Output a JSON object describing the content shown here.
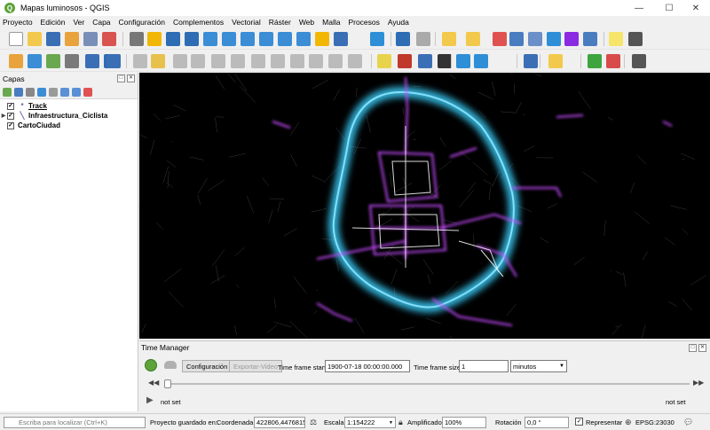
{
  "window": {
    "title": "Mapas luminosos - QGIS"
  },
  "menu": [
    "Proyecto",
    "Edición",
    "Ver",
    "Capa",
    "Configuración",
    "Complementos",
    "Vectorial",
    "Ráster",
    "Web",
    "Malla",
    "Procesos",
    "Ayuda"
  ],
  "toolbar_top": [
    {
      "icon": "new-project-icon",
      "color": "#ffffff"
    },
    {
      "icon": "open-project-icon",
      "color": "#f2c94c"
    },
    {
      "icon": "save-project-icon",
      "color": "#3b6fb5"
    },
    {
      "icon": "save-as-icon",
      "color": "#e8a33c"
    },
    {
      "icon": "print-layout-icon",
      "color": "#7a8fb8"
    },
    {
      "icon": "style-manager-icon",
      "color": "#d9534f"
    },
    {
      "icon": "pan-icon",
      "color": "#777777"
    },
    {
      "icon": "pan-to-selection-icon",
      "color": "#f2b705"
    },
    {
      "icon": "zoom-in-icon",
      "color": "#2e6db4"
    },
    {
      "icon": "zoom-out-icon",
      "color": "#2e6db4"
    },
    {
      "icon": "zoom-full-icon",
      "color": "#3b8dd6"
    },
    {
      "icon": "zoom-selection-icon",
      "color": "#3b8dd6"
    },
    {
      "icon": "zoom-layer-icon",
      "color": "#3b8dd6"
    },
    {
      "icon": "zoom-native-icon",
      "color": "#3b8dd6"
    },
    {
      "icon": "zoom-last-icon",
      "color": "#3b8dd6"
    },
    {
      "icon": "zoom-next-icon",
      "color": "#3b8dd6"
    },
    {
      "icon": "new-bookmark-icon",
      "color": "#f2b705"
    },
    {
      "icon": "show-bookmarks-icon",
      "color": "#3b6fb5"
    },
    {
      "icon": "refresh-icon",
      "color": "#2e8fd6"
    },
    {
      "icon": "identify-icon",
      "color": "#2e6db4"
    },
    {
      "icon": "action-icon",
      "color": "#aaaaaa"
    },
    {
      "icon": "select-feature-icon",
      "color": "#f2c94c"
    },
    {
      "icon": "select-value-icon",
      "color": "#f2c94c"
    },
    {
      "icon": "deselect-icon",
      "color": "#e05252"
    },
    {
      "icon": "attribute-table-icon",
      "color": "#4a7cc0"
    },
    {
      "icon": "field-calculator-icon",
      "color": "#6b8fc9"
    },
    {
      "icon": "toolbox-icon",
      "color": "#2e8fd6"
    },
    {
      "icon": "statistics-icon",
      "color": "#8a2be2"
    },
    {
      "icon": "measure-icon",
      "color": "#4a7cc0"
    },
    {
      "icon": "map-tips-icon",
      "color": "#f7e46b"
    },
    {
      "icon": "text-annotation-icon",
      "color": "#555555"
    }
  ],
  "toolbar_second": [
    {
      "icon": "datasource-manager-icon",
      "color": "#e8a33c"
    },
    {
      "icon": "new-geopackage-icon",
      "color": "#3b8dd6"
    },
    {
      "icon": "add-vector-icon",
      "color": "#6aa84f"
    },
    {
      "icon": "add-delimited-text-icon",
      "color": "#7a7a7a"
    },
    {
      "icon": "new-shapefile-icon",
      "color": "#3b6fb5"
    },
    {
      "icon": "new-spatialite-icon",
      "color": "#2e6db4"
    },
    {
      "icon": "virtual-layer-icon",
      "color": "#3b6fb5"
    },
    {
      "icon": "edit-pencil-icon",
      "color": "#bbbbbb"
    },
    {
      "icon": "toggle-edit-icon",
      "color": "#e8c04c"
    },
    {
      "icon": "save-edits-icon",
      "color": "#bbbbbb"
    },
    {
      "icon": "digitize-icon",
      "color": "#bbbbbb"
    },
    {
      "icon": "vertex-tool-icon",
      "color": "#bbbbbb"
    },
    {
      "icon": "modify-attributes-icon",
      "color": "#bbbbbb"
    },
    {
      "icon": "delete-selected-icon",
      "color": "#bbbbbb"
    },
    {
      "icon": "cut-features-icon",
      "color": "#bbbbbb"
    },
    {
      "icon": "copy-features-icon",
      "color": "#bbbbbb"
    },
    {
      "icon": "paste-features-icon",
      "color": "#bbbbbb"
    },
    {
      "icon": "undo-icon",
      "color": "#bbbbbb"
    },
    {
      "icon": "redo-icon",
      "color": "#bbbbbb"
    },
    {
      "icon": "label-toolbar-icon",
      "color": "#e8d44c"
    },
    {
      "icon": "layer-labeling-icon",
      "color": "#c0392b"
    },
    {
      "icon": "label-options-icon",
      "color": "#3b6fb5"
    },
    {
      "icon": "more-tools-icon",
      "color": "#333333"
    },
    {
      "icon": "time-manager-icon",
      "color": "#2e8fd6"
    },
    {
      "icon": "time-settings-icon",
      "color": "#2e8fd6"
    },
    {
      "icon": "help-icon",
      "color": "#3b6fb5"
    },
    {
      "icon": "python-console-icon",
      "color": "#f2c94c"
    },
    {
      "icon": "search-plugin-icon",
      "color": "#3ea53e"
    },
    {
      "icon": "plugin-tool-icon",
      "color": "#d94b4b"
    },
    {
      "icon": "whats-this-icon",
      "color": "#555555"
    }
  ],
  "layers_panel": {
    "title": "Capas",
    "layers": [
      {
        "name": "Track",
        "checked": true,
        "expandable": false,
        "symbol": "*"
      },
      {
        "name": "Infraestructura_Ciclista",
        "checked": true,
        "expandable": true,
        "symbol": "╲"
      },
      {
        "name": "CartoCiudad",
        "checked": true,
        "expandable": false,
        "symbol": ""
      }
    ]
  },
  "time_manager": {
    "title": "Time Manager",
    "config_button": "Configuración",
    "export_button": "Exportar-Video",
    "frame_start_label": "Time frame start",
    "frame_start_value": "1900-07-18 00:00:00.000",
    "frame_size_label": "Time frame size",
    "frame_size_value": "1",
    "unit_value": "minutos",
    "progress": 0,
    "left_status": "not set",
    "right_status": "not set"
  },
  "statusbar": {
    "search_placeholder": "Escriba para localizar (Ctrl+K)",
    "project_saved": "Proyecto guardado en:",
    "coord_label": "Coordenada",
    "coord_value": "422806,4476815",
    "scale_label": "Escala",
    "scale_value": "1:154222",
    "magnifier_label": "Amplificador",
    "magnifier_value": "100%",
    "rotation_label": "Rotación",
    "rotation_value": "0,0 °",
    "render_label": "Representar",
    "crs": "EPSG:23030"
  },
  "colors": {
    "map_background": "#000000",
    "glow_cyan": "#39c6f0",
    "route_magenta": "#c64cff",
    "route_white": "#ffffff",
    "accent_green": "#5ca339"
  }
}
